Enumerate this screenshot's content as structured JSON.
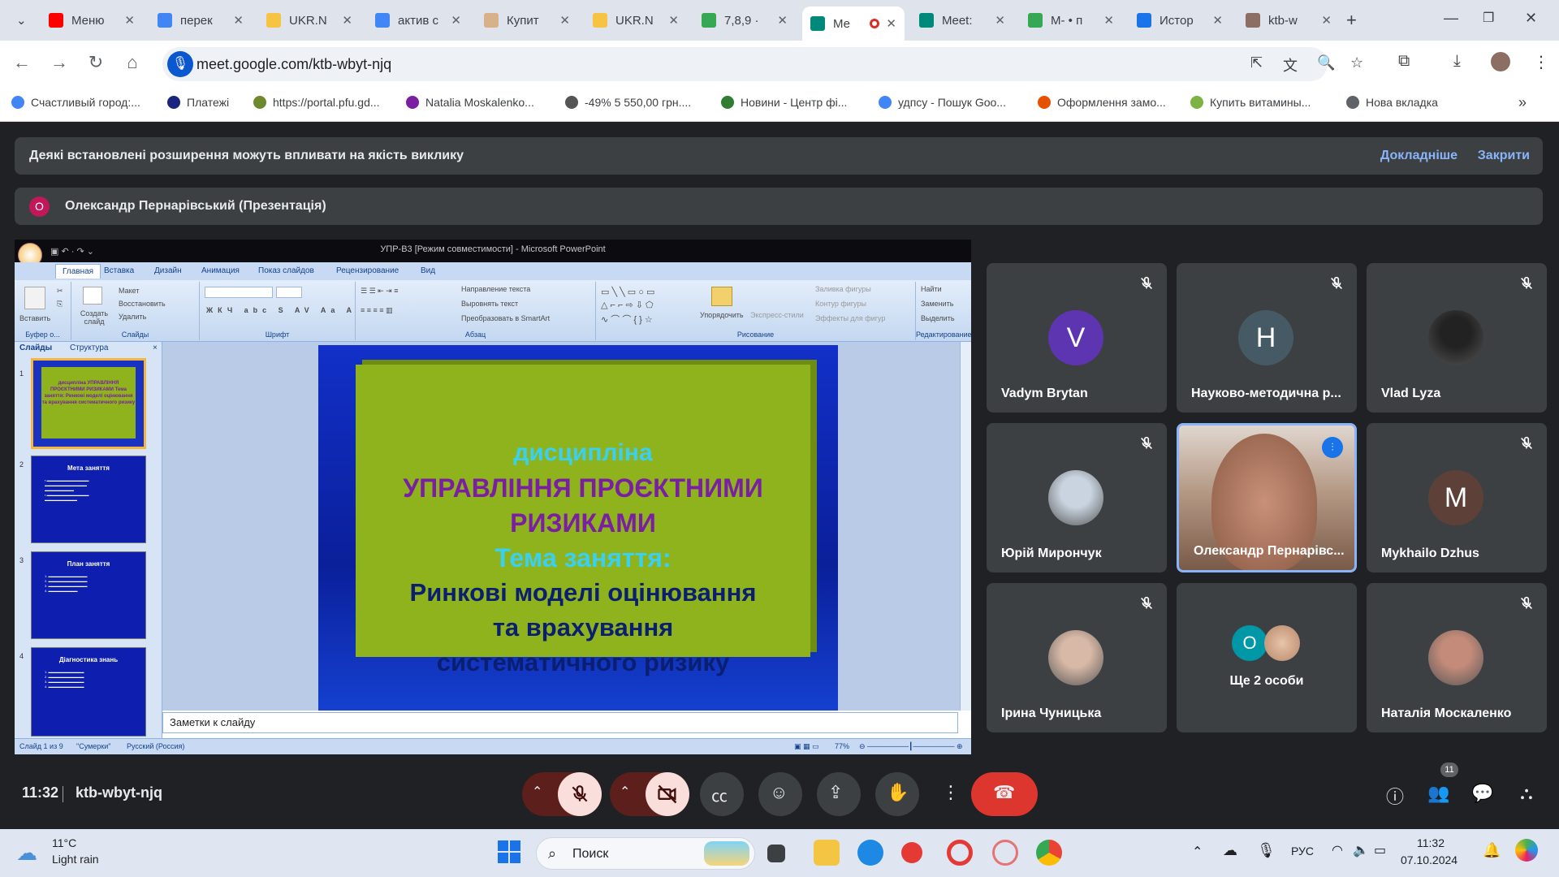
{
  "browser": {
    "tabs": [
      {
        "title": "Меню",
        "favicon": "youtube-icon",
        "color": "#ff0000"
      },
      {
        "title": "перек",
        "favicon": "google-icon",
        "color": "#4285f4"
      },
      {
        "title": "UKR.N",
        "favicon": "ukrnet-icon",
        "color": "#f6c342"
      },
      {
        "title": "актив с",
        "favicon": "google-icon",
        "color": "#4285f4"
      },
      {
        "title": "Купит",
        "favicon": "shop-icon",
        "color": "#d7b18a"
      },
      {
        "title": "UKR.N",
        "favicon": "ukrnet-icon",
        "color": "#f6c342"
      },
      {
        "title": "7,8,9 ·",
        "favicon": "classroom-icon",
        "color": "#34a853"
      },
      {
        "title": "Ме",
        "favicon": "meet-icon",
        "color": "#00897b",
        "active": true
      },
      {
        "title": "Meet:",
        "favicon": "meet-icon",
        "color": "#00897b"
      },
      {
        "title": "М- • п",
        "favicon": "classroom-icon",
        "color": "#34a853"
      },
      {
        "title": "Истор",
        "favicon": "download-icon",
        "color": "#1a73e8"
      },
      {
        "title": "ktb-w",
        "favicon": "site-icon",
        "color": "#8d6e63"
      }
    ],
    "url": "meet.google.com/ktb-wbyt-njq",
    "bookmarks": [
      {
        "label": "Счастливый город:...",
        "color": "#4285f4"
      },
      {
        "label": "Платежі",
        "color": "#1a237e"
      },
      {
        "label": "https://portal.pfu.gd...",
        "color": "#6d8a2e"
      },
      {
        "label": "Natalia Moskalenko...",
        "color": "#7b1fa2"
      },
      {
        "label": "-49% 5 550,00 грн....",
        "color": "#555555"
      },
      {
        "label": "Новини - Центр фі...",
        "color": "#2e7d32"
      },
      {
        "label": "удпсу - Пошук Goo...",
        "color": "#4285f4"
      },
      {
        "label": "Оформлення замо...",
        "color": "#e65100"
      },
      {
        "label": "Купить витамины...",
        "color": "#7cb342"
      },
      {
        "label": "Нова вкладка",
        "color": "#5f6368"
      }
    ]
  },
  "meet": {
    "warning_text": "Деякі встановлені розширення можуть впливати на якість виклику",
    "warning_more": "Докладніше",
    "warning_close": "Закрити",
    "presenter_initial": "О",
    "presenter_label": "Олександр Пернарівський (Презентація)",
    "time": "11:32",
    "meeting_code": "ktb-wbyt-njq",
    "participants_count": "11",
    "tiles": [
      {
        "name": "Vadym Brytan",
        "initial": "V",
        "avatar_color": "#5e35b1",
        "muted": true
      },
      {
        "name": "Науково-методична р...",
        "initial": "Н",
        "avatar_color": "#455a64",
        "muted": true
      },
      {
        "name": "Vlad Lyza",
        "muted": true
      },
      {
        "name": "Юрій Мирончук",
        "muted": true
      },
      {
        "name": "Олександр Пернарівс...",
        "muted": false,
        "speaking": true
      },
      {
        "name": "Mykhailo Dzhus",
        "initial": "M",
        "avatar_color": "#5d4037",
        "muted": true
      },
      {
        "name": "Ірина Чуницька",
        "muted": true
      },
      {
        "name": "Ще 2 особи",
        "initial": "О",
        "avatar_color": "#0097a7"
      },
      {
        "name": "Наталія Москаленко",
        "muted": true
      }
    ]
  },
  "ppt": {
    "title": "УПР-В3 [Режим совместимости] - Microsoft PowerPoint",
    "tabs": [
      "Главная",
      "Вставка",
      "Дизайн",
      "Анимация",
      "Показ слайдов",
      "Рецензирование",
      "Вид"
    ],
    "groups": [
      "Буфер о...",
      "Слайды",
      "Шрифт",
      "Абзац",
      "Рисование",
      "Редактирование"
    ],
    "clipboard": [
      "Вставить"
    ],
    "slides_group": [
      "Создать слайд",
      "Макет",
      "Восстановить",
      "Удалить"
    ],
    "paragraph": [
      "Направление текста",
      "Выровнять текст",
      "Преобразовать в SmartArt"
    ],
    "drawing": [
      "Упорядочить",
      "Экспресс-стили",
      "Заливка фигуры",
      "Контур фигуры",
      "Эффекты для фигур"
    ],
    "editing": [
      "Найти",
      "Заменить",
      "Выделить"
    ],
    "panel_tabs": [
      "Слайды",
      "Структура"
    ],
    "thumbs": [
      {
        "num": "1",
        "title": "дисципліна УПРАВЛІННЯ ПРОЄКТНИМИ РИЗИКАМИ Тема заняття: Ринкові моделі оцінювання та врахування систематичного ризику"
      },
      {
        "num": "2",
        "title": "Мета заняття"
      },
      {
        "num": "3",
        "title": "План заняття"
      },
      {
        "num": "4",
        "title": "Діагностика знань"
      }
    ],
    "slide": {
      "line1": "дисципліна",
      "line2": "УПРАВЛІННЯ ПРОЄКТНИМИ",
      "line3": "РИЗИКАМИ",
      "line4": "Тема заняття:",
      "line5": "Ринкові моделі оцінювання",
      "line6": "та врахування",
      "line7": "систематичного ризику"
    },
    "notes": "Заметки к слайду",
    "status_slide": "Слайд 1 из 9",
    "status_theme": "\"Сумерки\"",
    "status_lang": "Русский (Россия)",
    "zoom": "77%"
  },
  "taskbar": {
    "weather_temp": "11°C",
    "weather_desc": "Light rain",
    "search_placeholder": "Поиск",
    "lang": "РУС",
    "clock_time": "11:32",
    "clock_date": "07.10.2024"
  }
}
